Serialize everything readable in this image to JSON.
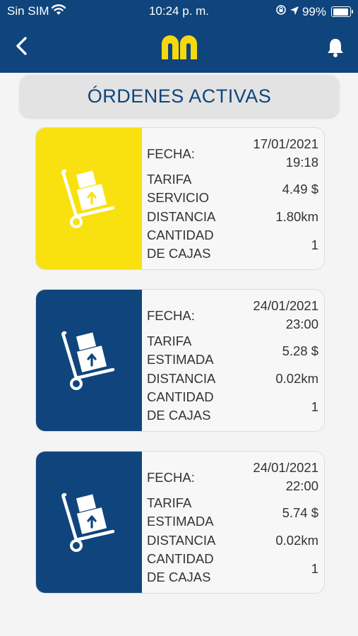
{
  "status_bar": {
    "carrier": "Sin SIM",
    "time": "10:24 p. m.",
    "battery": "99%",
    "battery_level": 0.99
  },
  "header": {
    "background": "#0f457c",
    "logo_color": "#f5d90f"
  },
  "page_title": "ÓRDENES ACTIVAS",
  "orders": [
    {
      "color": "#f8e10f",
      "fecha_label": "FECHA:",
      "fecha_date": "17/01/2021",
      "fecha_time": "19:18",
      "tarifa_label_1": "TARIFA",
      "tarifa_label_2": "SERVICIO",
      "tarifa_value": "4.49 $",
      "distancia_label": "DISTANCIA",
      "distancia_value": "1.80km",
      "cajas_label_1": "CANTIDAD",
      "cajas_label_2": "DE CAJAS",
      "cajas_value": "1"
    },
    {
      "color": "#0f457c",
      "fecha_label": "FECHA:",
      "fecha_date": "24/01/2021",
      "fecha_time": "23:00",
      "tarifa_label_1": "TARIFA",
      "tarifa_label_2": "ESTIMADA",
      "tarifa_value": "5.28 $",
      "distancia_label": "DISTANCIA",
      "distancia_value": "0.02km",
      "cajas_label_1": "CANTIDAD",
      "cajas_label_2": "DE CAJAS",
      "cajas_value": "1"
    },
    {
      "color": "#0f457c",
      "fecha_label": "FECHA:",
      "fecha_date": "24/01/2021",
      "fecha_time": "22:00",
      "tarifa_label_1": "TARIFA",
      "tarifa_label_2": "ESTIMADA",
      "tarifa_value": "5.74 $",
      "distancia_label": "DISTANCIA",
      "distancia_value": "0.02km",
      "cajas_label_1": "CANTIDAD",
      "cajas_label_2": "DE CAJAS",
      "cajas_value": "1"
    }
  ],
  "icons": [
    "wifi-icon",
    "location-lock-icon",
    "location-arrow-icon",
    "battery-icon",
    "back-chevron-icon",
    "logo-icon",
    "bell-icon",
    "hand-truck-box-icon"
  ]
}
